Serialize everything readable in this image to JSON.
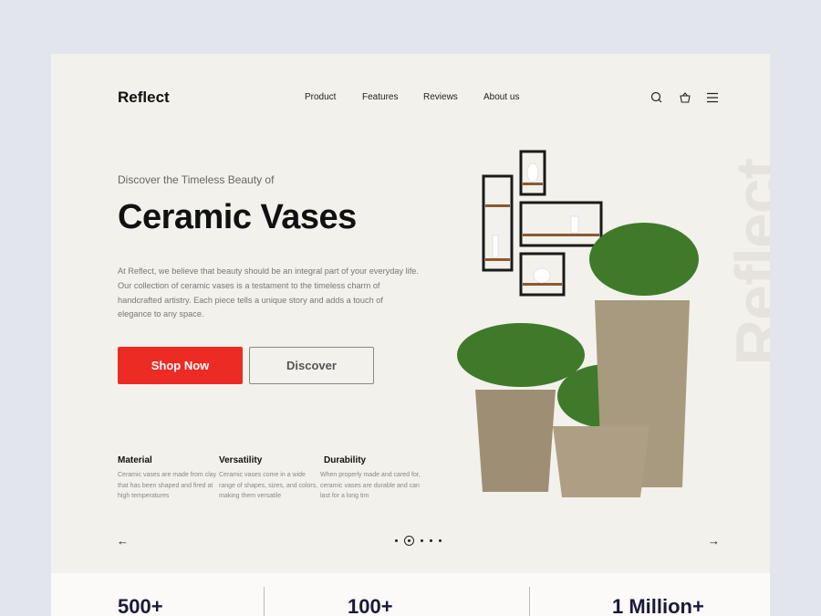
{
  "brand": "Reflect",
  "nav": [
    "Product",
    "Features",
    "Reviews",
    "About us"
  ],
  "icons": [
    "search-icon",
    "basket-icon",
    "menu-icon"
  ],
  "hero": {
    "subtitle": "Discover the Timeless Beauty of",
    "title": "Ceramic Vases",
    "description": "At Reflect, we believe that beauty should be an integral part of your everyday life. Our collection of ceramic vases is a testament to the timeless charm of handcrafted artistry. Each piece tells a unique story and adds a touch of elegance to any space.",
    "primary_button": "Shop Now",
    "secondary_button": "Discover",
    "watermark": "Reflect"
  },
  "features": [
    {
      "title": "Material",
      "text": "Ceramic vases are made from clay that has been shaped and fired at high temperatures"
    },
    {
      "title": "Versatility",
      "text": "Ceramic vases come in a wide range of shapes, sizes, and colors, making them versatile"
    },
    {
      "title": "Durability",
      "text": "When properly made and cared for, ceramic vases are durable and can last for a long tim"
    }
  ],
  "carousel": {
    "prev": "←",
    "next": "→",
    "total": 5,
    "active": 2
  },
  "stats": [
    "500+",
    "100+",
    "1 Million+"
  ],
  "colors": {
    "accent": "#ec2b25",
    "background": "#f3f1ec"
  }
}
